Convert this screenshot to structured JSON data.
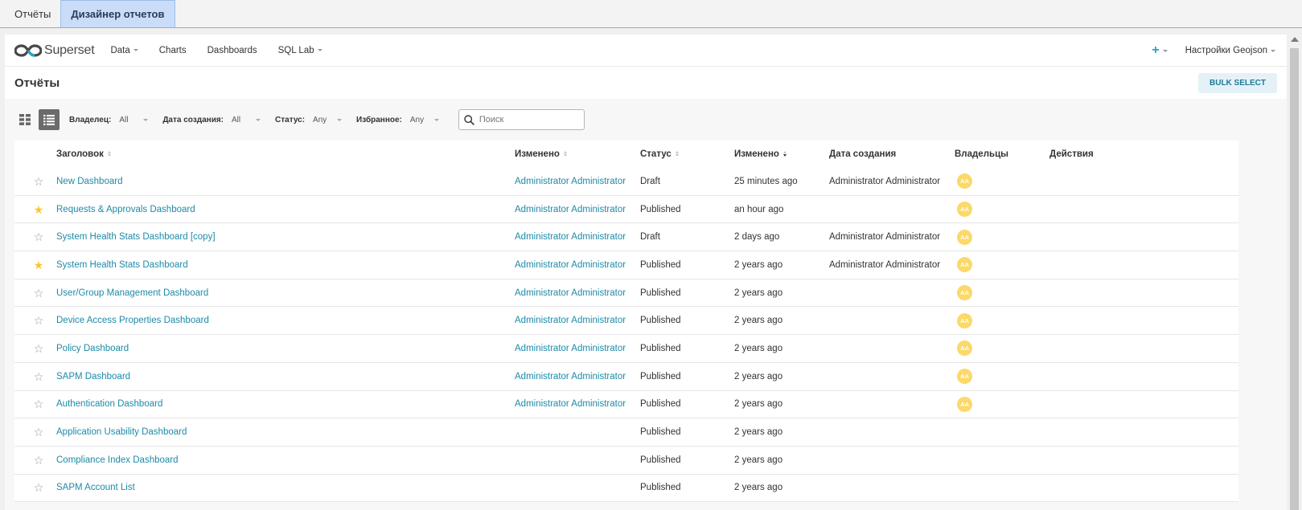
{
  "window_tabs": [
    {
      "label": "Отчёты",
      "active": false
    },
    {
      "label": "Дизайнер отчетов",
      "active": true
    }
  ],
  "navbar": {
    "brand": "Superset",
    "items": [
      {
        "label": "Data",
        "dropdown": true
      },
      {
        "label": "Charts",
        "dropdown": false
      },
      {
        "label": "Dashboards",
        "dropdown": false
      },
      {
        "label": "SQL Lab",
        "dropdown": true
      }
    ],
    "settings_label": "Настройки Geojson",
    "plus_icon": "plus-icon"
  },
  "page": {
    "title": "Отчёты",
    "bulk_select_label": "BULK SELECT"
  },
  "filters": {
    "owner": {
      "label": "Владелец:",
      "value": "All"
    },
    "created_date": {
      "label": "Дата создания:",
      "value": "All"
    },
    "status": {
      "label": "Статус:",
      "value": "Any"
    },
    "favorite": {
      "label": "Избранное:",
      "value": "Any"
    },
    "search_placeholder": "Поиск"
  },
  "table": {
    "columns": {
      "title": "Заголовок",
      "modified_by": "Изменено",
      "status": "Статус",
      "changed": "Изменено",
      "created": "Дата создания",
      "owners": "Владельцы",
      "actions": "Действия"
    },
    "rows": [
      {
        "starred": false,
        "title": "New Dashboard",
        "modified_by": "Administrator Administrator",
        "status": "Draft",
        "changed": "25 minutes ago",
        "created_by": "Administrator Administrator",
        "owner": "AA"
      },
      {
        "starred": true,
        "title": "Requests & Approvals Dashboard",
        "modified_by": "Administrator Administrator",
        "status": "Published",
        "changed": "an hour ago",
        "created_by": "",
        "owner": "AA"
      },
      {
        "starred": false,
        "title": "System Health Stats Dashboard [copy]",
        "modified_by": "Administrator Administrator",
        "status": "Draft",
        "changed": "2 days ago",
        "created_by": "Administrator Administrator",
        "owner": "AA"
      },
      {
        "starred": true,
        "title": "System Health Stats Dashboard",
        "modified_by": "Administrator Administrator",
        "status": "Published",
        "changed": "2 years ago",
        "created_by": "Administrator Administrator",
        "owner": "AA"
      },
      {
        "starred": false,
        "title": "User/Group Management Dashboard",
        "modified_by": "Administrator Administrator",
        "status": "Published",
        "changed": "2 years ago",
        "created_by": "",
        "owner": "AA"
      },
      {
        "starred": false,
        "title": "Device Access Properties Dashboard",
        "modified_by": "Administrator Administrator",
        "status": "Published",
        "changed": "2 years ago",
        "created_by": "",
        "owner": "AA"
      },
      {
        "starred": false,
        "title": "Policy Dashboard",
        "modified_by": "Administrator Administrator",
        "status": "Published",
        "changed": "2 years ago",
        "created_by": "",
        "owner": "AA"
      },
      {
        "starred": false,
        "title": "SAPM Dashboard",
        "modified_by": "Administrator Administrator",
        "status": "Published",
        "changed": "2 years ago",
        "created_by": "",
        "owner": "AA"
      },
      {
        "starred": false,
        "title": "Authentication Dashboard",
        "modified_by": "Administrator Administrator",
        "status": "Published",
        "changed": "2 years ago",
        "created_by": "",
        "owner": "AA"
      },
      {
        "starred": false,
        "title": "Application Usability Dashboard",
        "modified_by": "",
        "status": "Published",
        "changed": "2 years ago",
        "created_by": "",
        "owner": ""
      },
      {
        "starred": false,
        "title": "Compliance Index Dashboard",
        "modified_by": "",
        "status": "Published",
        "changed": "2 years ago",
        "created_by": "",
        "owner": ""
      },
      {
        "starred": false,
        "title": "SAPM Account List",
        "modified_by": "",
        "status": "Published",
        "changed": "2 years ago",
        "created_by": "",
        "owner": ""
      }
    ]
  },
  "colors": {
    "link": "#1d8aa8",
    "star_on": "#fcc52a",
    "avatar": "#fbd96a",
    "accent": "#20a7c9"
  }
}
